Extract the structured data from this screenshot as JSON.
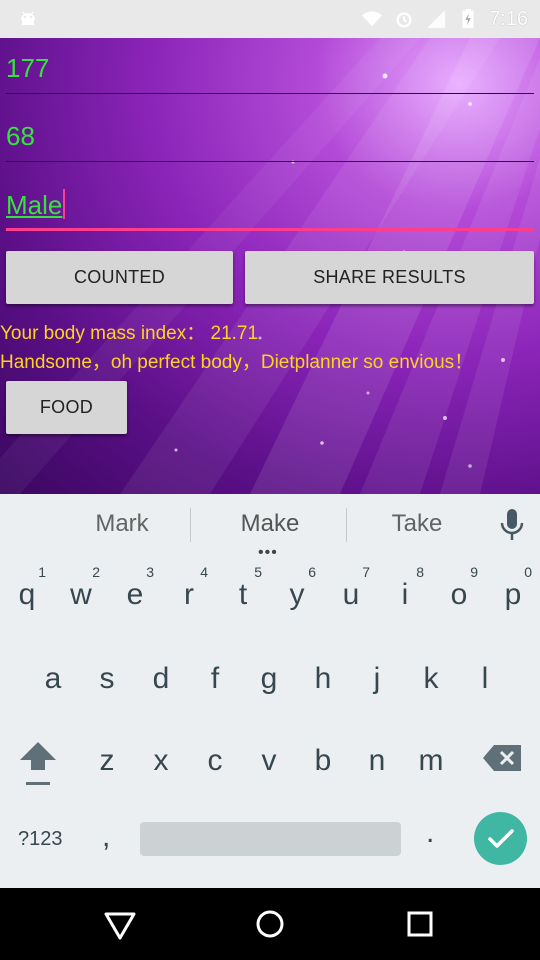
{
  "status_bar": {
    "time": "7:16",
    "icons": [
      "android-icon",
      "wifi-icon",
      "alarm-icon",
      "signal-icon",
      "battery-charging-icon"
    ]
  },
  "form": {
    "height_value": "177",
    "weight_value": "68",
    "gender_value": "Male"
  },
  "buttons": {
    "counted": "COUNTED",
    "share_results": "SHARE RESULTS",
    "food": "FOOD"
  },
  "results": {
    "bmi_line": "Your body mass index：  21.71",
    "comment_line": "Handsome，oh perfect body，Dietplanner so envious！"
  },
  "keyboard": {
    "suggestions": [
      "Mark",
      "Make",
      "Take"
    ],
    "row1": [
      {
        "key": "q",
        "hint": "1"
      },
      {
        "key": "w",
        "hint": "2"
      },
      {
        "key": "e",
        "hint": "3"
      },
      {
        "key": "r",
        "hint": "4"
      },
      {
        "key": "t",
        "hint": "5"
      },
      {
        "key": "y",
        "hint": "6"
      },
      {
        "key": "u",
        "hint": "7"
      },
      {
        "key": "i",
        "hint": "8"
      },
      {
        "key": "o",
        "hint": "9"
      },
      {
        "key": "p",
        "hint": "0"
      }
    ],
    "row2": [
      "a",
      "s",
      "d",
      "f",
      "g",
      "h",
      "j",
      "k",
      "l"
    ],
    "row3": [
      "z",
      "x",
      "c",
      "v",
      "b",
      "n",
      "m"
    ],
    "symbols_label": "?123",
    "comma": ",",
    "period": "."
  },
  "colors": {
    "input_text": "#33e53a",
    "focus_line": "#ff3d8e",
    "result_text": "#ffd21f",
    "enter_key": "#3fb7a3"
  }
}
